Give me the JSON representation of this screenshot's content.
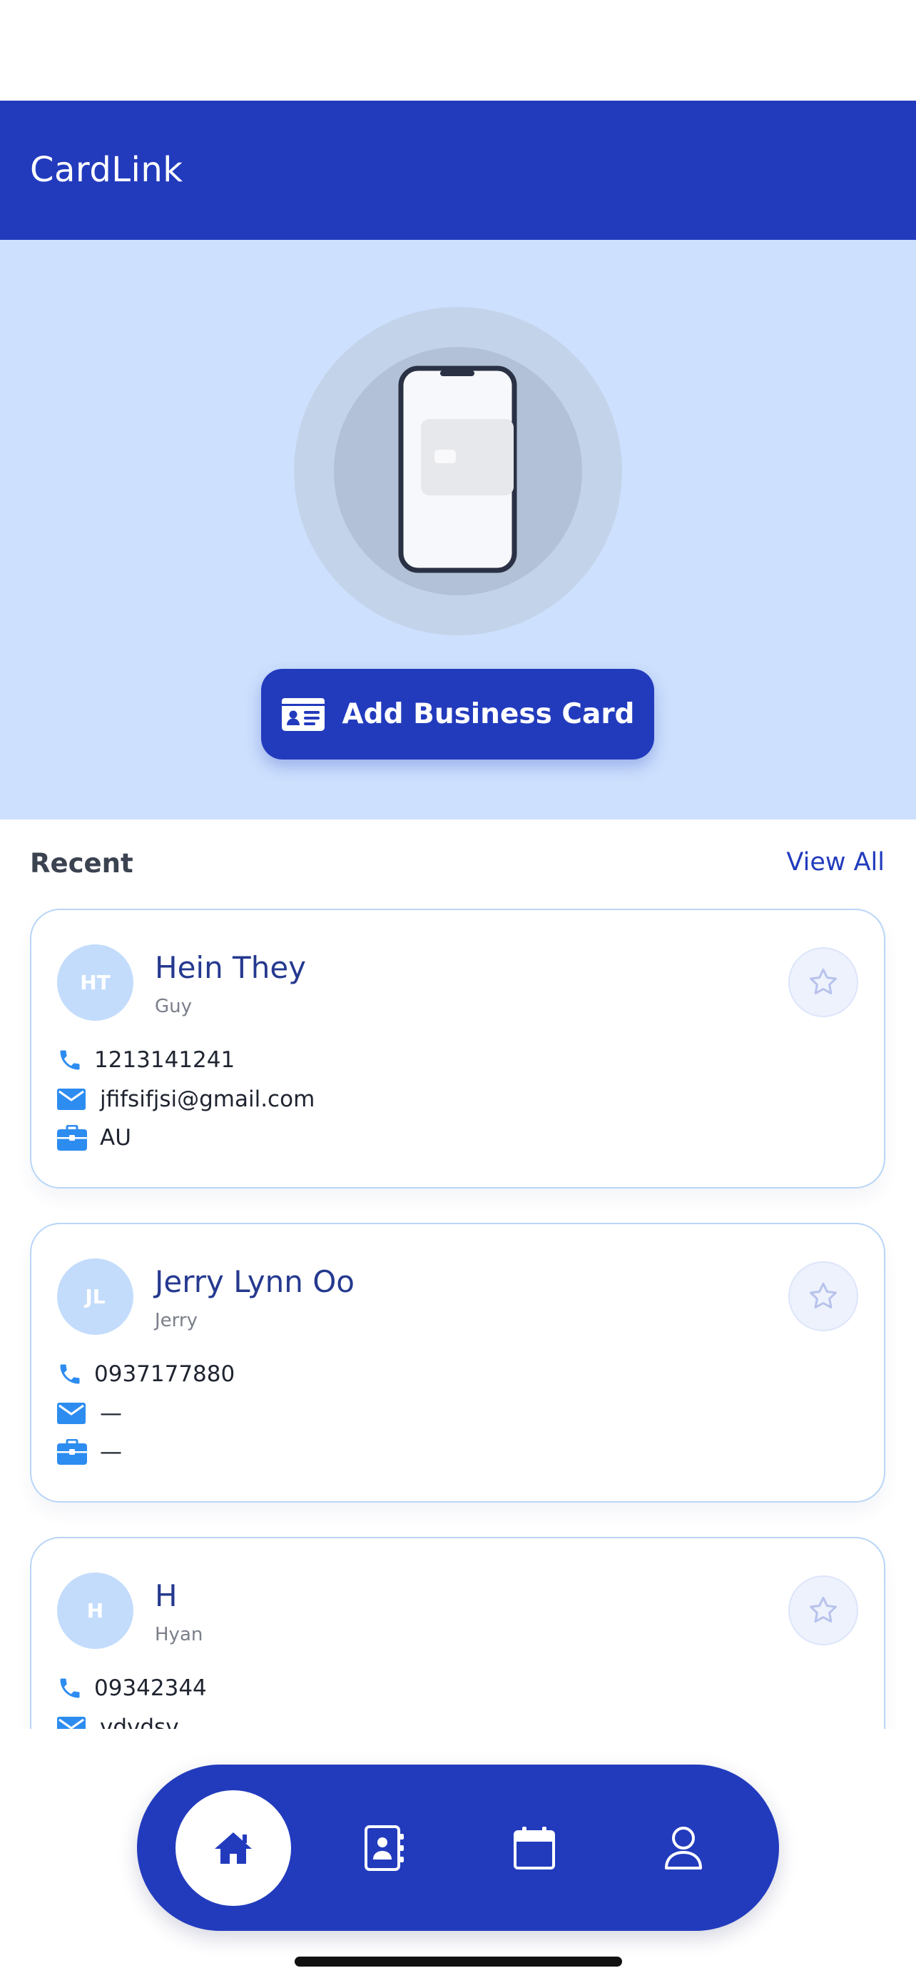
{
  "app": {
    "title": "CardLink"
  },
  "colors": {
    "primary": "#223bbd",
    "hero_bg": "#cde0fd",
    "accent_icon": "#2d8cf0",
    "avatar_bg": "#c3dcfc"
  },
  "hero": {
    "illustration_icon": "phone-with-card-illustration",
    "button_icon": "id-card-icon",
    "button_label": "Add Business Card"
  },
  "recent": {
    "title": "Recent",
    "view_all": "View All"
  },
  "contacts": [
    {
      "initials": "HT",
      "name": "Hein They",
      "subtitle": "Guy",
      "phone": "1213141241",
      "email": "jfifsifjsi@gmail.com",
      "company": "AU",
      "starred": false
    },
    {
      "initials": "JL",
      "name": "Jerry Lynn Oo",
      "subtitle": "Jerry",
      "phone": "0937177880",
      "email": "—",
      "company": "—",
      "starred": false
    },
    {
      "initials": "H",
      "name": "H",
      "subtitle": "Hyan",
      "phone": "09342344",
      "email": "vdvdsv",
      "company": "",
      "starred": false
    }
  ],
  "nav": [
    {
      "icon": "home-icon",
      "active": true
    },
    {
      "icon": "contact-book-icon",
      "active": false
    },
    {
      "icon": "calendar-icon",
      "active": false
    },
    {
      "icon": "profile-icon",
      "active": false
    }
  ]
}
